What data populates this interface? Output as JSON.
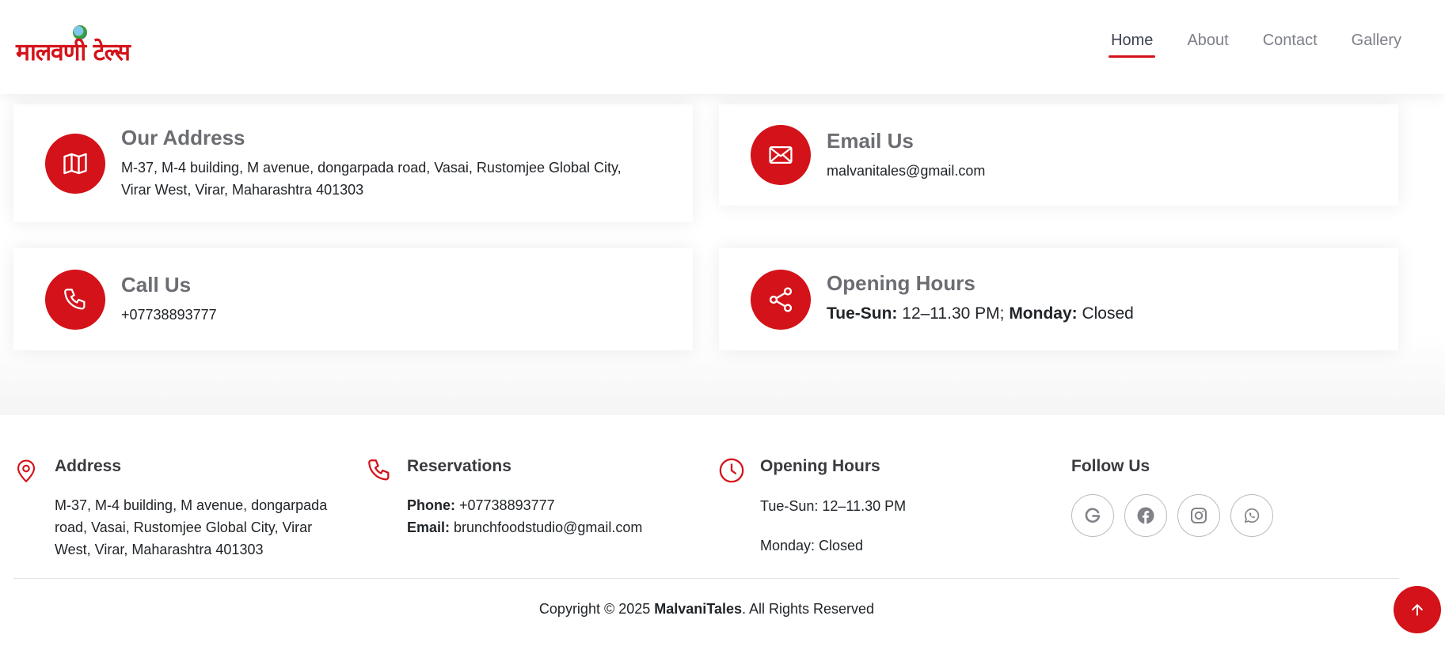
{
  "brand": {
    "logo_text": "मालवणी टेल्स",
    "accent_color": "#d41219"
  },
  "nav": [
    {
      "label": "Home",
      "active": true
    },
    {
      "label": "About",
      "active": false
    },
    {
      "label": "Contact",
      "active": false
    },
    {
      "label": "Gallery",
      "active": false
    }
  ],
  "contact_cards": {
    "address": {
      "icon": "map-icon",
      "title": "Our Address",
      "line1": "M-37, M-4 building, M avenue, dongarpada road, Vasai, Rustomjee Global City,",
      "line2": "Virar West, Virar, Maharashtra 401303"
    },
    "email": {
      "icon": "envelope-icon",
      "title": "Email Us",
      "value": "malvanitales@gmail.com"
    },
    "call": {
      "icon": "phone-icon",
      "title": "Call Us",
      "value": "+07738893777"
    },
    "hours": {
      "icon": "share-icon",
      "title": "Opening Hours",
      "days_label": "Tue-Sun:",
      "days_value": " 12–11.30 PM; ",
      "closed_label": "Monday:",
      "closed_value": " Closed"
    }
  },
  "footer": {
    "address": {
      "icon": "map-pin-icon",
      "title": "Address",
      "line1": "M-37, M-4 building, M avenue, dongarpada",
      "line2": "road, Vasai, Rustomjee Global City, Virar",
      "line3": "West, Virar, Maharashtra 401303"
    },
    "reservations": {
      "icon": "phone-icon",
      "title": "Reservations",
      "phone_label": "Phone:",
      "phone_value": " +07738893777",
      "email_label": "Email:",
      "email_value": " brunchfoodstudio@gmail.com"
    },
    "hours": {
      "icon": "clock-icon",
      "title": "Opening Hours",
      "line1": "Tue-Sun: 12–11.30 PM",
      "line2": "Monday: Closed"
    },
    "follow": {
      "title": "Follow Us",
      "socials": [
        "google-icon",
        "facebook-icon",
        "instagram-icon",
        "whatsapp-icon"
      ]
    }
  },
  "copyright": {
    "prefix": "Copyright © 2025 ",
    "brand": "MalvaniTales",
    "suffix": ". All Rights Reserved"
  },
  "back_to_top": {
    "icon": "arrow-up-icon"
  }
}
